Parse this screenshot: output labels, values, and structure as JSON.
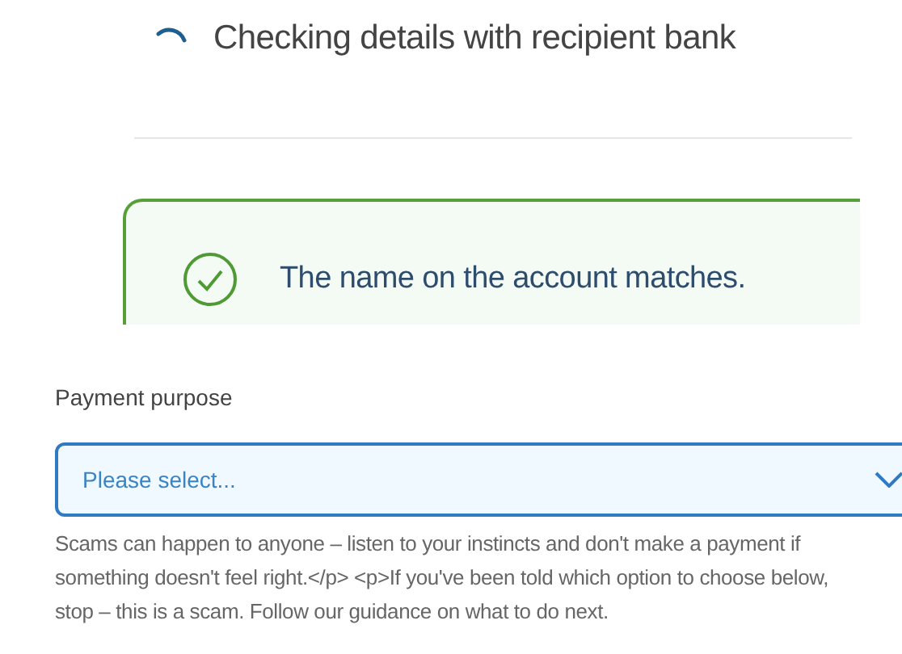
{
  "status": {
    "loading": true,
    "text": "Checking details with recipient bank"
  },
  "name_check": {
    "matched": true,
    "message": "The name on the account matches."
  },
  "payment_purpose": {
    "label": "Payment purpose",
    "placeholder": "Please select...",
    "help": "Scams can happen to anyone – listen to your instincts and don't make a payment if something doesn't feel right.</p> <p>If you've been told which option to choose below, stop – this is a scam. Follow our guidance on what to do next."
  }
}
